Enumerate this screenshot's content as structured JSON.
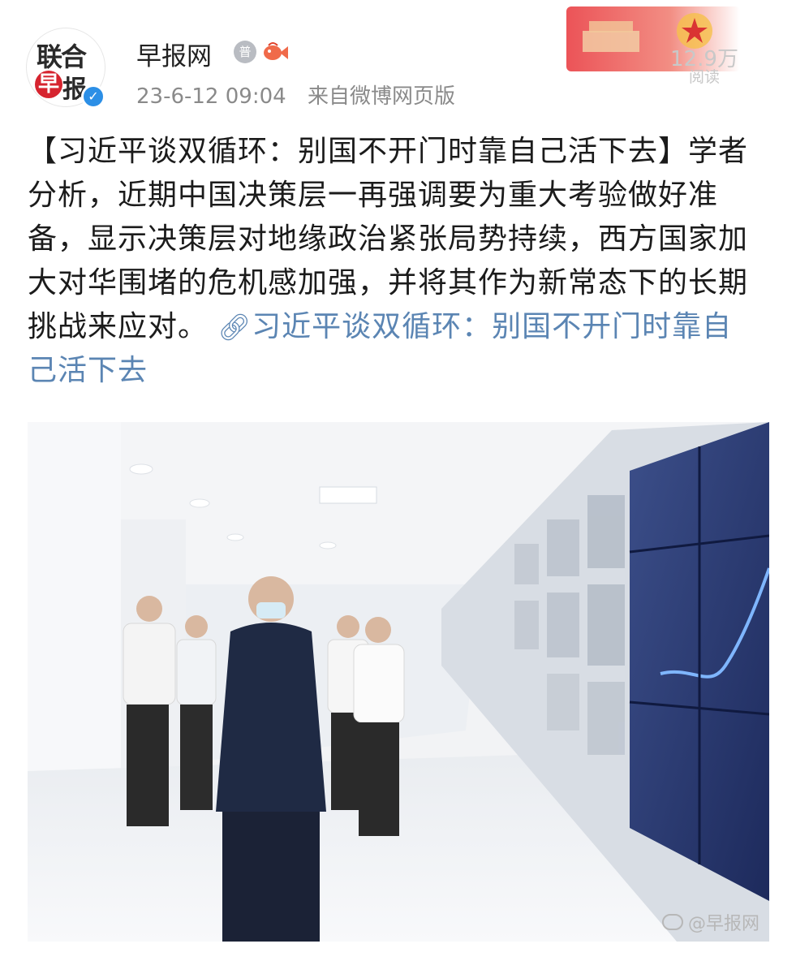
{
  "account": {
    "name": "早报网",
    "avatar_logo": "联合早报",
    "logo_top": "联合",
    "logo_char_left": "早",
    "logo_char_right": "报",
    "verified_icon": "check-icon",
    "level_badge_text": "普"
  },
  "meta": {
    "timestamp": "23-6-12 09:04",
    "source": "来自微博网页版"
  },
  "read_stats": {
    "count": "12.9万",
    "label": "阅读"
  },
  "post": {
    "text": "【习近平谈双循环：别国不开门时靠自己活下去】学者分析，近期中国决策层一再强调要为重大考验做好准备，显示决策层对地缘政治紧张局势持续，西方国家加大对华围堵的危机感加强，并将其作为新常态下的长期挑战来应对。",
    "link_text": "习近平谈双循环：别国不开门时靠自己活下去"
  },
  "photo": {
    "watermark": "@早报网"
  },
  "colors": {
    "link": "#5b85b3",
    "meta_gray": "#8a8a8a",
    "badge_blue": "#2c8fe6",
    "brand_red": "#d6242f"
  }
}
